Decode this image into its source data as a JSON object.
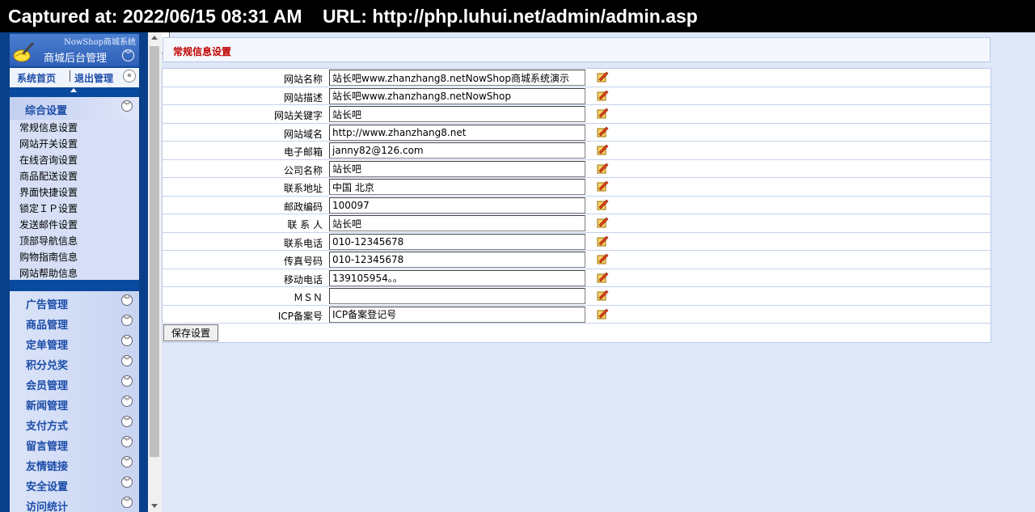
{
  "capture_bar": "Captured at: 2022/06/15 08:31 AM    URL: http://php.luhui.net/admin/admin.asp",
  "brand": {
    "system_name": "NowShop商城系统",
    "title": "商城后台管理"
  },
  "topnav": {
    "home": "系统首页",
    "logout": "退出管理"
  },
  "settings_menu": {
    "title": "综合设置",
    "items": [
      "常规信息设置",
      "网站开关设置",
      "在线咨询设置",
      "商品配送设置",
      "界面快捷设置",
      "锁定ＩＰ设置",
      "发送邮件设置",
      "顶部导航信息",
      "购物指南信息",
      "网站帮助信息"
    ]
  },
  "categories": [
    "广告管理",
    "商品管理",
    "定单管理",
    "积分兑奖",
    "会员管理",
    "新闻管理",
    "支付方式",
    "留言管理",
    "友情链接",
    "安全设置",
    "访问统计"
  ],
  "page": {
    "section_title": "常规信息设置",
    "fields": [
      {
        "label": "网站名称",
        "value": "站长吧www.zhanzhang8.netNowShop商城系统演示"
      },
      {
        "label": "网站描述",
        "value": "站长吧www.zhanzhang8.netNowShop"
      },
      {
        "label": "网站关键字",
        "value": "站长吧"
      },
      {
        "label": "网站域名",
        "value": "http://www.zhanzhang8.net"
      },
      {
        "label": "电子邮箱",
        "value": "janny82@126.com"
      },
      {
        "label": "公司名称",
        "value": "站长吧"
      },
      {
        "label": "联系地址",
        "value": "中国 北京"
      },
      {
        "label": "邮政编码",
        "value": "100097"
      },
      {
        "label": "联 系 人",
        "value": "站长吧"
      },
      {
        "label": "联系电话",
        "value": "010-12345678"
      },
      {
        "label": "传真号码",
        "value": "010-12345678"
      },
      {
        "label": "移动电话",
        "value": "139105954。。"
      },
      {
        "label": "ＭＳＮ",
        "value": ""
      },
      {
        "label": "ICP备案号",
        "value": "ICP备案登记号"
      }
    ],
    "save_label": "保存设置"
  },
  "colors": {
    "sidebar_bg": "#0a4a9e",
    "main_bg": "#dfe8f8",
    "title_red": "#c00000",
    "link_blue": "#1d4da8"
  }
}
